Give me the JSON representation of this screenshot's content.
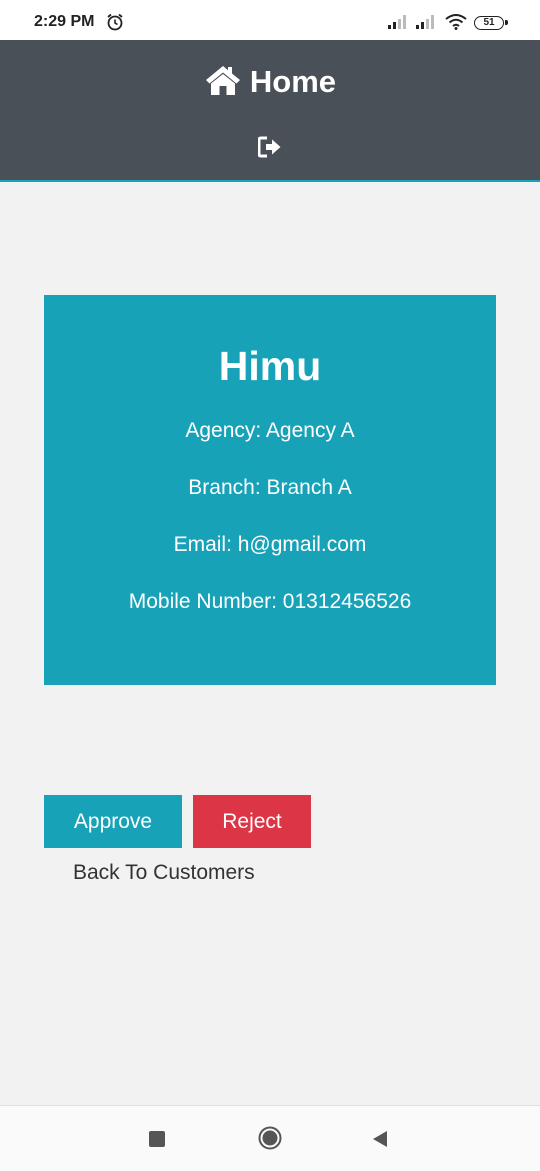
{
  "status_bar": {
    "time": "2:29 PM",
    "battery": "51",
    "icons": [
      "alarm-icon",
      "signal-icon",
      "signal-icon",
      "wifi-icon",
      "battery-icon"
    ]
  },
  "header": {
    "title": "Home",
    "icon": "home-icon",
    "logout_icon": "sign-out-icon",
    "background": "#495057"
  },
  "customer": {
    "name": "Himu",
    "agency": "Agency: Agency A",
    "branch": "Branch: Branch A",
    "email": "Email: h@gmail.com",
    "mobile": "Mobile Number: 01312456526"
  },
  "actions": {
    "approve_label": "Approve",
    "reject_label": "Reject",
    "back_label": "Back To Customers"
  },
  "colors": {
    "accent": "#17a2b8",
    "danger": "#dc3545",
    "background": "#f2f2f2"
  },
  "nav_bar": {
    "icons": [
      "recents-square-icon",
      "home-circle-icon",
      "back-triangle-icon"
    ]
  }
}
